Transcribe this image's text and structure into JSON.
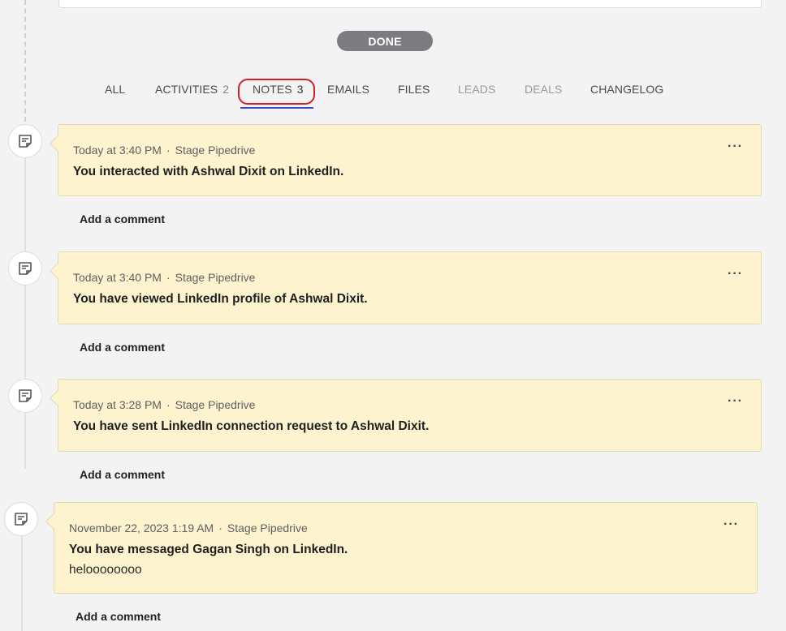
{
  "done_button": "DONE",
  "tabs": [
    {
      "label": "ALL",
      "count": ""
    },
    {
      "label": "ACTIVITIES",
      "count": "2"
    },
    {
      "label": "NOTES",
      "count": "3"
    },
    {
      "label": "EMAILS",
      "count": ""
    },
    {
      "label": "FILES",
      "count": ""
    },
    {
      "label": "LEADS",
      "count": ""
    },
    {
      "label": "DEALS",
      "count": ""
    },
    {
      "label": "CHANGELOG",
      "count": ""
    }
  ],
  "active_tab": "NOTES",
  "notes": [
    {
      "time": "Today at 3:40 PM",
      "source": "Stage Pipedrive",
      "title": "You interacted with Ashwal Dixit on LinkedIn.",
      "body": "",
      "more": "···",
      "comment_label": "Add a comment"
    },
    {
      "time": "Today at 3:40 PM",
      "source": "Stage Pipedrive",
      "title": "You have viewed LinkedIn profile of Ashwal Dixit.",
      "body": "",
      "more": "···",
      "comment_label": "Add a comment"
    },
    {
      "time": "Today at 3:28 PM",
      "source": "Stage Pipedrive",
      "title": "You have sent LinkedIn connection request to Ashwal Dixit.",
      "body": "",
      "more": "···",
      "comment_label": "Add a comment"
    },
    {
      "time": "November 22, 2023 1:19 AM",
      "source": "Stage Pipedrive",
      "title": "You have messaged Gagan Singh on LinkedIn.",
      "body": "heloooooooo",
      "more": "···",
      "comment_label": "Add a comment"
    }
  ],
  "colors": {
    "note_bg": "#fdf3cf",
    "active_ring": "#d11f26",
    "active_underline": "#3f4cc8",
    "done_button_bg": "#7a7c80"
  }
}
